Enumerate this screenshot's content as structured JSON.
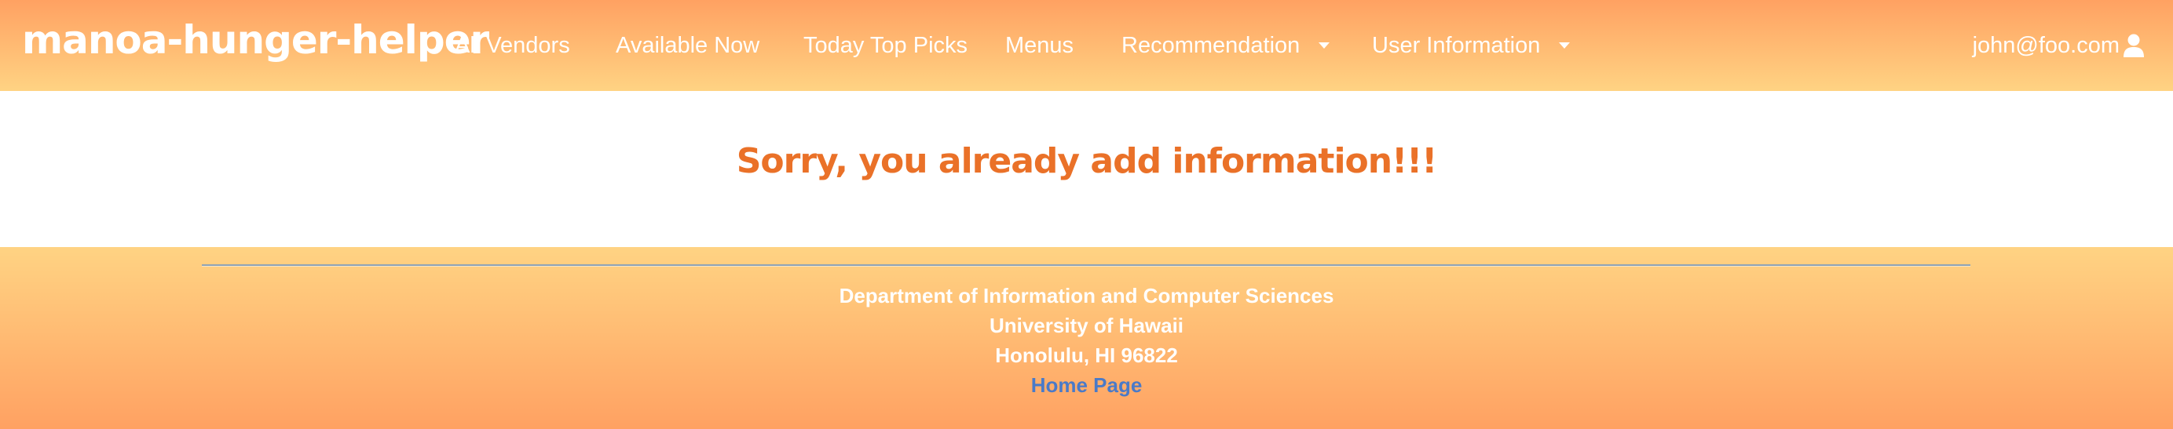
{
  "navbar": {
    "brand": "manoa-hunger-helper",
    "items": [
      {
        "label": "All Vendors"
      },
      {
        "label": "Available Now"
      },
      {
        "label": "Today Top Picks"
      },
      {
        "label": "Menus"
      },
      {
        "label": "Recommendation",
        "dropdown": true
      },
      {
        "label": "User Information",
        "dropdown": true
      }
    ],
    "user": {
      "email": "john@foo.com",
      "icon": "user-icon"
    }
  },
  "main": {
    "message": "Sorry, you already add information!!!"
  },
  "footer": {
    "department": "Department of Information and Computer Sciences",
    "university": "University of Hawaii",
    "address": "Honolulu, HI 96822",
    "home_link": "Home Page"
  },
  "colors": {
    "nav_gradient_top": "#ffa162",
    "nav_gradient_bottom": "#ffd383",
    "message": "#ea7128",
    "link": "#4a7ac8"
  }
}
